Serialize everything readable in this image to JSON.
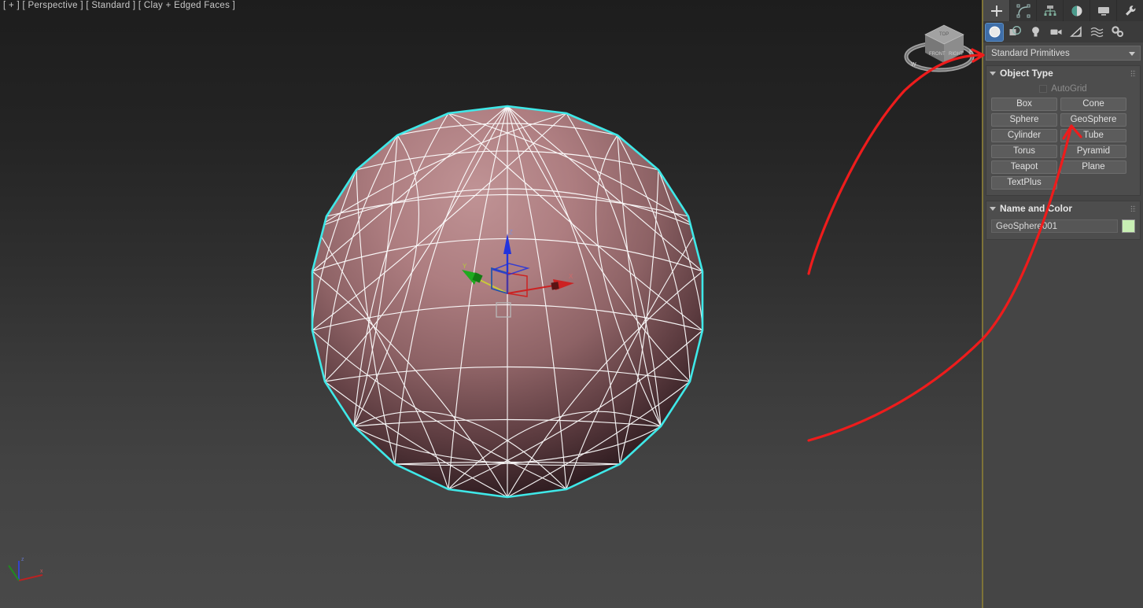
{
  "viewport": {
    "label": "[ + ] [ Perspective ] [ Standard ] [ Clay + Edged Faces ]",
    "background_top": "#1d1d1d",
    "background_bottom": "#494949",
    "border_color": "#7e7338"
  },
  "object": {
    "type": "GeoSphere",
    "selection_outline_color": "#3fe8e8",
    "edge_color": "#ffffff",
    "surface_top_color": "#b8888a",
    "surface_bottom_color": "#1b1113",
    "shading": "Clay + Edged Faces"
  },
  "gizmo": {
    "mode": "move",
    "axes": [
      {
        "name": "x-axis",
        "label": "X",
        "color": "#cc2222"
      },
      {
        "name": "y-axis",
        "label": "Y",
        "color": "#22aa22"
      },
      {
        "name": "z-axis",
        "label": "Z",
        "color": "#2233cc"
      }
    ]
  },
  "tripod": {
    "axes": [
      {
        "label": "z",
        "color": "#3344cc"
      },
      {
        "label": "x",
        "color": "#bb2222"
      },
      {
        "label": "y",
        "color": "#228822"
      }
    ]
  },
  "viewcube": {
    "name": "ViewCube",
    "compass_labels": [
      "W",
      "N",
      "E",
      "S"
    ]
  },
  "command_panel": {
    "tabs": [
      {
        "name": "create",
        "icon": "plus-icon",
        "active": true
      },
      {
        "name": "modify",
        "icon": "modify-curve-icon",
        "active": false
      },
      {
        "name": "hierarchy",
        "icon": "hierarchy-tree-icon",
        "active": false
      },
      {
        "name": "motion",
        "icon": "motion-wheel-icon",
        "active": false
      },
      {
        "name": "display",
        "icon": "display-monitor-icon",
        "active": false
      },
      {
        "name": "utilities",
        "icon": "wrench-icon",
        "active": false
      }
    ],
    "category_buttons": [
      {
        "name": "geometry",
        "icon": "sphere-icon",
        "selected": true
      },
      {
        "name": "shapes",
        "icon": "shapes-icon",
        "selected": false
      },
      {
        "name": "lights",
        "icon": "lightbulb-icon",
        "selected": false
      },
      {
        "name": "cameras",
        "icon": "camera-icon",
        "selected": false
      },
      {
        "name": "helpers",
        "icon": "tape-measure-icon",
        "selected": false
      },
      {
        "name": "space-warps",
        "icon": "waves-icon",
        "selected": false
      },
      {
        "name": "systems",
        "icon": "gears-icon",
        "selected": false
      }
    ],
    "category_dropdown": {
      "value": "Standard Primitives",
      "icon": "chevron-down-icon"
    },
    "object_type": {
      "title": "Object Type",
      "autogrid": {
        "label": "AutoGrid",
        "checked": false,
        "enabled": false
      },
      "buttons": [
        "Box",
        "Cone",
        "Sphere",
        "GeoSphere",
        "Cylinder",
        "Tube",
        "Torus",
        "Pyramid",
        "Teapot",
        "Plane",
        "TextPlus"
      ]
    },
    "name_and_color": {
      "title": "Name and Color",
      "name_value": "GeoSphere001",
      "color_swatch": "#c8efb4"
    }
  },
  "annotations": {
    "color": "#ee1c1c",
    "arrows": [
      {
        "name": "arrow-to-standard-primitives",
        "target": "Standard Primitives"
      },
      {
        "name": "arrow-to-geosphere-button",
        "target": "GeoSphere"
      }
    ]
  }
}
